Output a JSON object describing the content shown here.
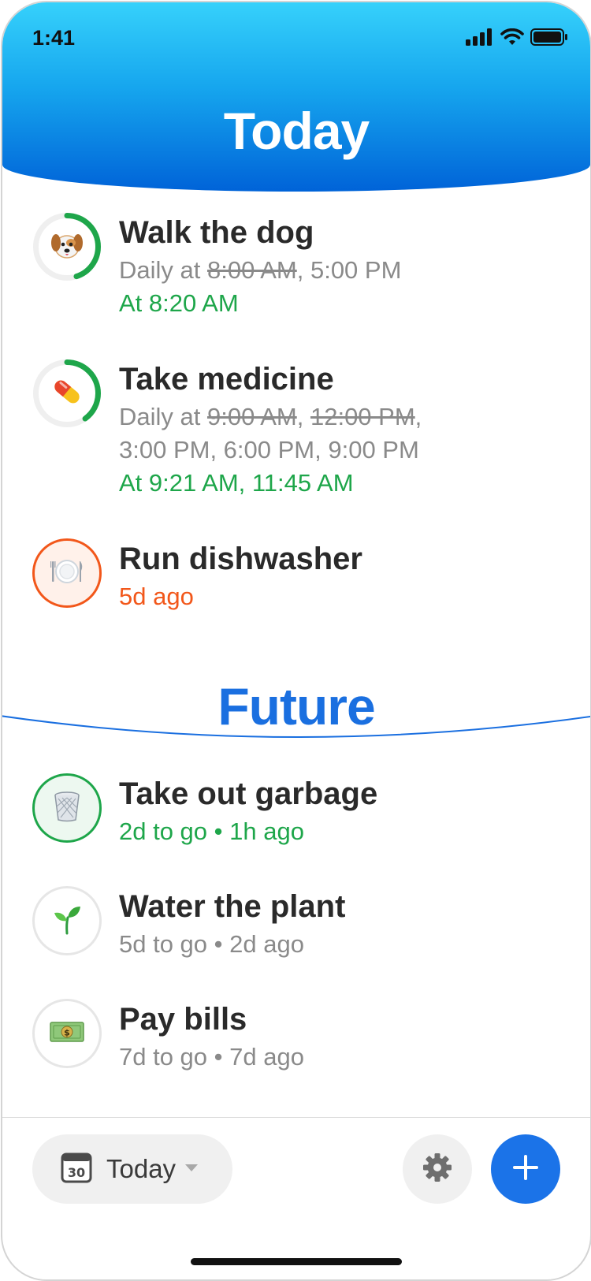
{
  "status_bar": {
    "time": "1:41"
  },
  "header": {
    "title": "Today"
  },
  "today_items": [
    {
      "title": "Walk the dog",
      "icon": "dog-face-icon",
      "progress": 0.45,
      "schedule_prefix": "Daily at ",
      "schedule_done": "8:00 AM",
      "schedule_rest": ", 5:00 PM",
      "status": "At 8:20 AM",
      "status_color": "#1ea64a"
    },
    {
      "title": "Take medicine",
      "icon": "pill-icon",
      "progress": 0.4,
      "schedule_prefix": "Daily at ",
      "schedule_done_1": "9:00 AM",
      "schedule_sep": ", ",
      "schedule_done_2": "12:00 PM",
      "schedule_rest_1": ",",
      "schedule_line2": "3:00 PM, 6:00 PM, 9:00 PM",
      "status": "At 9:21 AM, 11:45 AM",
      "status_color": "#1ea64a"
    },
    {
      "title": "Run dishwasher",
      "icon": "plate-with-cutlery-icon",
      "status": "5d ago",
      "status_color": "#f2571a"
    }
  ],
  "future": {
    "title": "Future"
  },
  "future_items": [
    {
      "title": "Take out garbage",
      "icon": "wastebasket-icon",
      "status": "2d to go • 1h ago",
      "status_color": "#1ea64a"
    },
    {
      "title": "Water the plant",
      "icon": "seedling-icon",
      "status": "5d to go • 2d ago",
      "status_color": "#8a8a8a"
    },
    {
      "title": "Pay bills",
      "icon": "dollar-banknote-icon",
      "status": "7d to go • 7d ago",
      "status_color": "#8a8a8a"
    }
  ],
  "toolbar": {
    "filter_label": "Today",
    "calendar_day": "30"
  },
  "colors": {
    "accent": "#1b73e8",
    "green": "#1ea64a",
    "orange": "#f2571a"
  }
}
